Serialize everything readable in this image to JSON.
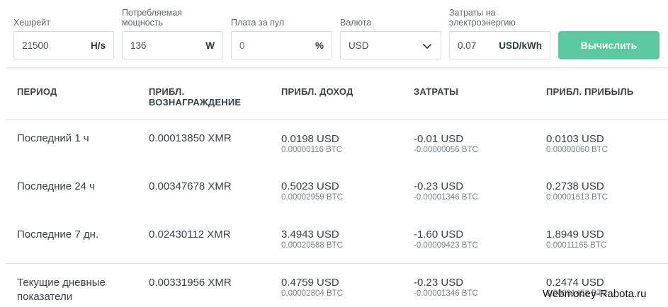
{
  "form": {
    "hashrate": {
      "label": "Хешрейт",
      "value": "21500",
      "unit": "H/s"
    },
    "power": {
      "label": "Потребляемая мощность",
      "value": "136",
      "unit": "W"
    },
    "pool_fee": {
      "label": "Плата за пул",
      "placeholder": "0",
      "unit": "%"
    },
    "currency": {
      "label": "Валюта",
      "selected": "USD",
      "icon": "chevron-down-icon"
    },
    "electricity": {
      "label": "Затраты на электроэнергию",
      "value": "0.07",
      "unit": "USD/kWh"
    },
    "calculate_label": "Вычислить",
    "accent_color": "#5ccaa0"
  },
  "table": {
    "headers": {
      "period": "ПЕРИОД",
      "reward": "ПРИБЛ. ВОЗНАГРАЖДЕНИЕ",
      "income": "ПРИБЛ. ДОХОД",
      "costs": "ЗАТРАТЫ",
      "profit": "ПРИБЛ. ПРИБЫЛЬ"
    },
    "rows": [
      {
        "period": "Последний 1 ч",
        "reward": "0.00013850 XMR",
        "income_usd": "0.0198 USD",
        "income_btc": "0.00000116 BTC",
        "costs_usd": "-0.01 USD",
        "costs_btc": "-0.00000056 BTC",
        "profit_usd": "0.0103 USD",
        "profit_btc": "0.00000060 BTC"
      },
      {
        "period": "Последние 24 ч",
        "reward": "0.00347678 XMR",
        "income_usd": "0.5023 USD",
        "income_btc": "0.00002959 BTC",
        "costs_usd": "-0.23 USD",
        "costs_btc": "-0.00001346 BTC",
        "profit_usd": "0.2738 USD",
        "profit_btc": "0.00001613 BTC"
      },
      {
        "period": "Последние 7 дн.",
        "reward": "0.02430112 XMR",
        "income_usd": "3.4943 USD",
        "income_btc": "0.00020588 BTC",
        "costs_usd": "-1.60 USD",
        "costs_btc": "-0.00009423 BTC",
        "profit_usd": "1.8949 USD",
        "profit_btc": "0.00011165 BTC"
      },
      {
        "period": "Текущие дневные показатели",
        "reward": "0.00331956 XMR",
        "income_usd": "0.4759 USD",
        "income_btc": "0.00002804 BTC",
        "costs_usd": "-0.23 USD",
        "costs_btc": "-0.00001346 BTC",
        "profit_usd": "0.2474 USD",
        "profit_btc": "0.00001458 BTC"
      }
    ]
  },
  "watermark": "Webmoney-Rabota.ru"
}
